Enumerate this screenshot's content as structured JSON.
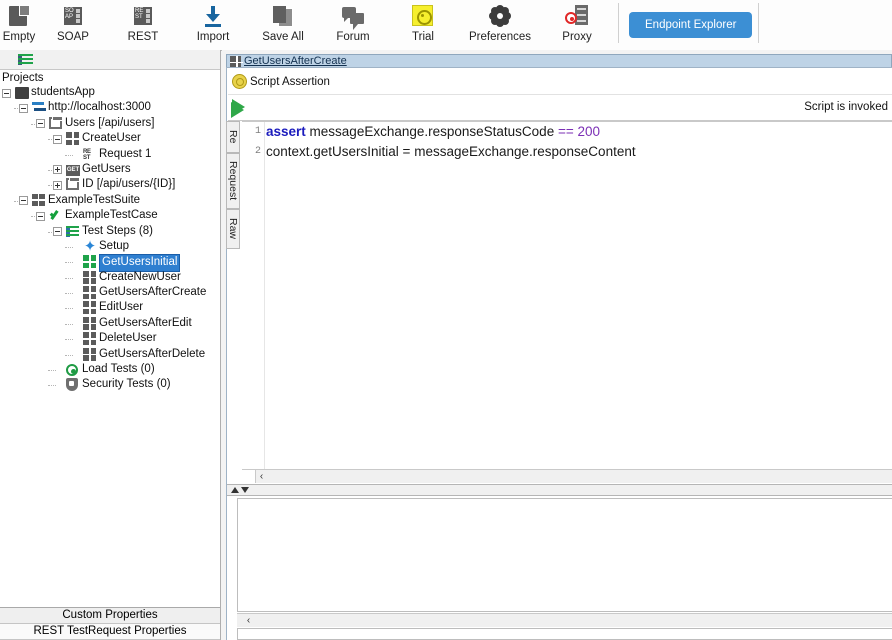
{
  "toolbar": {
    "items": [
      {
        "label": "Empty",
        "icon": "empty-project-icon"
      },
      {
        "label": "SOAP",
        "icon": "soap-project-icon"
      },
      {
        "label": "REST",
        "icon": "rest-project-icon"
      },
      {
        "label": "Import",
        "icon": "import-icon"
      },
      {
        "label": "Save All",
        "icon": "save-all-icon"
      },
      {
        "label": "Forum",
        "icon": "forum-icon"
      },
      {
        "label": "Trial",
        "icon": "trial-icon"
      },
      {
        "label": "Preferences",
        "icon": "preferences-gear-icon"
      },
      {
        "label": "Proxy",
        "icon": "proxy-icon"
      }
    ],
    "endpoint_explorer_label": "Endpoint Explorer",
    "accent_blue": "#3c8fd4",
    "trial_highlight": "#f6ef2e"
  },
  "sidebar": {
    "header": "Projects",
    "toolbar_icon": "navigator-list-icon",
    "tree": [
      {
        "label": "studentsApp",
        "indent": 0,
        "icon": "folder-icon",
        "expander": "minus",
        "selected": false
      },
      {
        "label": "http://localhost:3000",
        "indent": 1,
        "icon": "service-arrows-icon",
        "expander": "minus",
        "selected": false
      },
      {
        "label": "Users [/api/users]",
        "indent": 2,
        "icon": "resource-icon",
        "expander": "minus",
        "selected": false
      },
      {
        "label": "CreateUser",
        "indent": 3,
        "icon": "method-grid-icon",
        "expander": "minus",
        "selected": false
      },
      {
        "label": "Request 1",
        "indent": 4,
        "icon": "rest-request-icon",
        "expander": "none",
        "selected": false
      },
      {
        "label": "GetUsers",
        "indent": 3,
        "icon": "get-method-icon",
        "expander": "plus",
        "selected": false
      },
      {
        "label": "ID [/api/users/{ID}]",
        "indent": 3,
        "icon": "resource-icon",
        "expander": "plus",
        "selected": false
      },
      {
        "label": "ExampleTestSuite",
        "indent": 1,
        "icon": "testsuite-icon",
        "expander": "minus",
        "selected": false
      },
      {
        "label": "ExampleTestCase",
        "indent": 2,
        "icon": "testcase-check-icon",
        "expander": "minus",
        "selected": false
      },
      {
        "label": "Test Steps (8)",
        "indent": 3,
        "icon": "teststeps-icon",
        "expander": "minus",
        "selected": false
      },
      {
        "label": "Setup",
        "indent": 4,
        "icon": "setup-star-icon",
        "expander": "none",
        "selected": false
      },
      {
        "label": "GetUsersInitial",
        "indent": 4,
        "icon": "teststep-grid-green-icon",
        "expander": "none",
        "selected": true
      },
      {
        "label": "CreateNewUser",
        "indent": 4,
        "icon": "teststep-grid-icon",
        "expander": "none",
        "selected": false
      },
      {
        "label": "GetUsersAfterCreate",
        "indent": 4,
        "icon": "teststep-grid-icon",
        "expander": "none",
        "selected": false
      },
      {
        "label": "EditUser",
        "indent": 4,
        "icon": "teststep-grid-icon",
        "expander": "none",
        "selected": false
      },
      {
        "label": "GetUsersAfterEdit",
        "indent": 4,
        "icon": "teststep-grid-icon",
        "expander": "none",
        "selected": false
      },
      {
        "label": "DeleteUser",
        "indent": 4,
        "icon": "teststep-grid-icon",
        "expander": "none",
        "selected": false
      },
      {
        "label": "GetUsersAfterDelete",
        "indent": 4,
        "icon": "teststep-grid-icon",
        "expander": "none",
        "selected": false
      },
      {
        "label": "Load Tests (0)",
        "indent": 3,
        "icon": "load-tests-icon",
        "expander": "none",
        "selected": false
      },
      {
        "label": "Security Tests (0)",
        "indent": 3,
        "icon": "security-tests-shield-icon",
        "expander": "none",
        "selected": false
      }
    ],
    "properties_tabs": [
      {
        "label": "Custom Properties",
        "active": false
      },
      {
        "label": "REST TestRequest Properties",
        "active": true
      }
    ],
    "selection_color": "#2f7fd0"
  },
  "editor": {
    "window_tab_title": "GetUsersAfterCreate",
    "window_tab_icon": "teststep-grid-icon",
    "window_tab_color": "#bed3e6",
    "assertion_title": "Script Assertion",
    "assertion_icon": "assertion-circle-icon",
    "run_button_icon": "run-play-icon",
    "run_script_icon": "run-script-play-icon",
    "script_status": "Script is invoked",
    "vertical_tabs": [
      {
        "label": "Re"
      },
      {
        "label": "Request"
      },
      {
        "label": "Raw"
      }
    ],
    "code": {
      "lines": [
        {
          "number": "1",
          "tokens": [
            {
              "text": "assert",
              "cls": "kw"
            },
            {
              "text": " messageExchange.responseStatusCode ",
              "cls": ""
            },
            {
              "text": "==",
              "cls": "op"
            },
            {
              "text": " ",
              "cls": ""
            },
            {
              "text": "200",
              "cls": "num"
            }
          ]
        },
        {
          "number": "2",
          "tokens": [
            {
              "text": "context.getUsersInitial = messageExchange.responseContent",
              "cls": ""
            }
          ]
        }
      ]
    },
    "scroll_left_arrow": "‹",
    "splitter_up_icon": "splitter-up-arrow-icon",
    "splitter_down_icon": "splitter-down-arrow-icon"
  }
}
